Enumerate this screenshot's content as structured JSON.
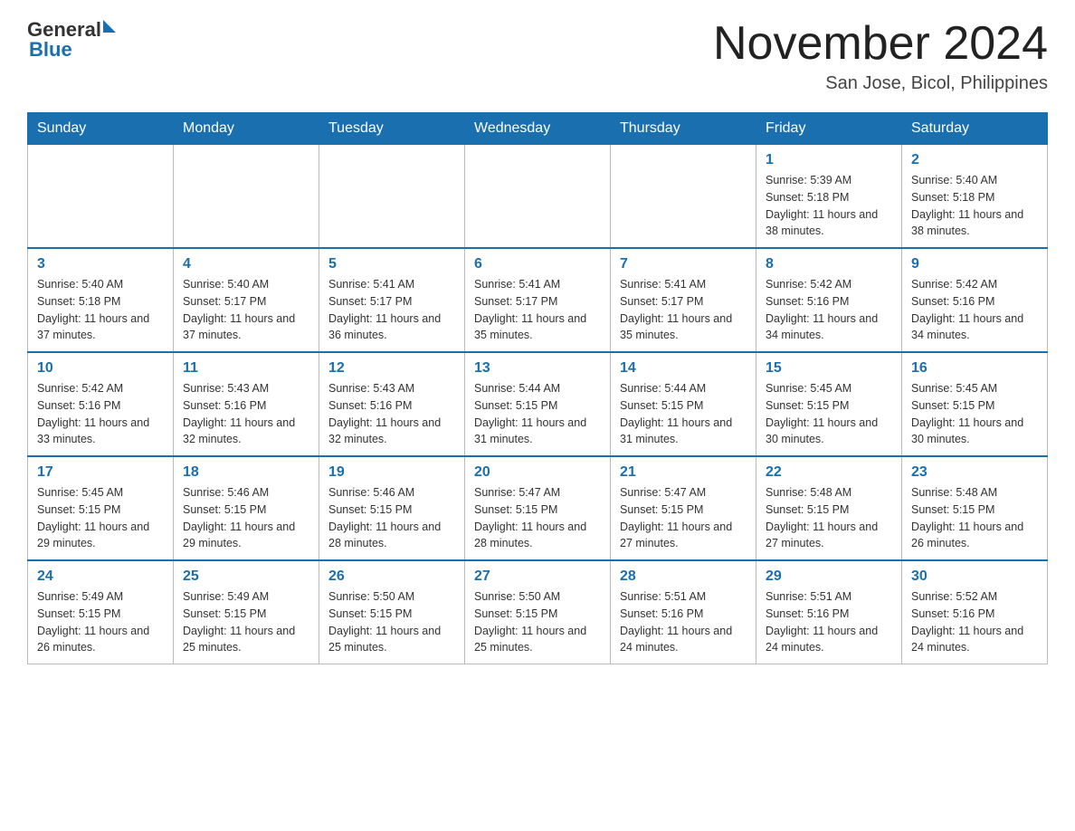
{
  "header": {
    "logo_general": "General",
    "logo_blue": "Blue",
    "month_year": "November 2024",
    "location": "San Jose, Bicol, Philippines"
  },
  "weekdays": [
    "Sunday",
    "Monday",
    "Tuesday",
    "Wednesday",
    "Thursday",
    "Friday",
    "Saturday"
  ],
  "weeks": [
    [
      {
        "day": "",
        "sunrise": "",
        "sunset": "",
        "daylight": ""
      },
      {
        "day": "",
        "sunrise": "",
        "sunset": "",
        "daylight": ""
      },
      {
        "day": "",
        "sunrise": "",
        "sunset": "",
        "daylight": ""
      },
      {
        "day": "",
        "sunrise": "",
        "sunset": "",
        "daylight": ""
      },
      {
        "day": "",
        "sunrise": "",
        "sunset": "",
        "daylight": ""
      },
      {
        "day": "1",
        "sunrise": "Sunrise: 5:39 AM",
        "sunset": "Sunset: 5:18 PM",
        "daylight": "Daylight: 11 hours and 38 minutes."
      },
      {
        "day": "2",
        "sunrise": "Sunrise: 5:40 AM",
        "sunset": "Sunset: 5:18 PM",
        "daylight": "Daylight: 11 hours and 38 minutes."
      }
    ],
    [
      {
        "day": "3",
        "sunrise": "Sunrise: 5:40 AM",
        "sunset": "Sunset: 5:18 PM",
        "daylight": "Daylight: 11 hours and 37 minutes."
      },
      {
        "day": "4",
        "sunrise": "Sunrise: 5:40 AM",
        "sunset": "Sunset: 5:17 PM",
        "daylight": "Daylight: 11 hours and 37 minutes."
      },
      {
        "day": "5",
        "sunrise": "Sunrise: 5:41 AM",
        "sunset": "Sunset: 5:17 PM",
        "daylight": "Daylight: 11 hours and 36 minutes."
      },
      {
        "day": "6",
        "sunrise": "Sunrise: 5:41 AM",
        "sunset": "Sunset: 5:17 PM",
        "daylight": "Daylight: 11 hours and 35 minutes."
      },
      {
        "day": "7",
        "sunrise": "Sunrise: 5:41 AM",
        "sunset": "Sunset: 5:17 PM",
        "daylight": "Daylight: 11 hours and 35 minutes."
      },
      {
        "day": "8",
        "sunrise": "Sunrise: 5:42 AM",
        "sunset": "Sunset: 5:16 PM",
        "daylight": "Daylight: 11 hours and 34 minutes."
      },
      {
        "day": "9",
        "sunrise": "Sunrise: 5:42 AM",
        "sunset": "Sunset: 5:16 PM",
        "daylight": "Daylight: 11 hours and 34 minutes."
      }
    ],
    [
      {
        "day": "10",
        "sunrise": "Sunrise: 5:42 AM",
        "sunset": "Sunset: 5:16 PM",
        "daylight": "Daylight: 11 hours and 33 minutes."
      },
      {
        "day": "11",
        "sunrise": "Sunrise: 5:43 AM",
        "sunset": "Sunset: 5:16 PM",
        "daylight": "Daylight: 11 hours and 32 minutes."
      },
      {
        "day": "12",
        "sunrise": "Sunrise: 5:43 AM",
        "sunset": "Sunset: 5:16 PM",
        "daylight": "Daylight: 11 hours and 32 minutes."
      },
      {
        "day": "13",
        "sunrise": "Sunrise: 5:44 AM",
        "sunset": "Sunset: 5:15 PM",
        "daylight": "Daylight: 11 hours and 31 minutes."
      },
      {
        "day": "14",
        "sunrise": "Sunrise: 5:44 AM",
        "sunset": "Sunset: 5:15 PM",
        "daylight": "Daylight: 11 hours and 31 minutes."
      },
      {
        "day": "15",
        "sunrise": "Sunrise: 5:45 AM",
        "sunset": "Sunset: 5:15 PM",
        "daylight": "Daylight: 11 hours and 30 minutes."
      },
      {
        "day": "16",
        "sunrise": "Sunrise: 5:45 AM",
        "sunset": "Sunset: 5:15 PM",
        "daylight": "Daylight: 11 hours and 30 minutes."
      }
    ],
    [
      {
        "day": "17",
        "sunrise": "Sunrise: 5:45 AM",
        "sunset": "Sunset: 5:15 PM",
        "daylight": "Daylight: 11 hours and 29 minutes."
      },
      {
        "day": "18",
        "sunrise": "Sunrise: 5:46 AM",
        "sunset": "Sunset: 5:15 PM",
        "daylight": "Daylight: 11 hours and 29 minutes."
      },
      {
        "day": "19",
        "sunrise": "Sunrise: 5:46 AM",
        "sunset": "Sunset: 5:15 PM",
        "daylight": "Daylight: 11 hours and 28 minutes."
      },
      {
        "day": "20",
        "sunrise": "Sunrise: 5:47 AM",
        "sunset": "Sunset: 5:15 PM",
        "daylight": "Daylight: 11 hours and 28 minutes."
      },
      {
        "day": "21",
        "sunrise": "Sunrise: 5:47 AM",
        "sunset": "Sunset: 5:15 PM",
        "daylight": "Daylight: 11 hours and 27 minutes."
      },
      {
        "day": "22",
        "sunrise": "Sunrise: 5:48 AM",
        "sunset": "Sunset: 5:15 PM",
        "daylight": "Daylight: 11 hours and 27 minutes."
      },
      {
        "day": "23",
        "sunrise": "Sunrise: 5:48 AM",
        "sunset": "Sunset: 5:15 PM",
        "daylight": "Daylight: 11 hours and 26 minutes."
      }
    ],
    [
      {
        "day": "24",
        "sunrise": "Sunrise: 5:49 AM",
        "sunset": "Sunset: 5:15 PM",
        "daylight": "Daylight: 11 hours and 26 minutes."
      },
      {
        "day": "25",
        "sunrise": "Sunrise: 5:49 AM",
        "sunset": "Sunset: 5:15 PM",
        "daylight": "Daylight: 11 hours and 25 minutes."
      },
      {
        "day": "26",
        "sunrise": "Sunrise: 5:50 AM",
        "sunset": "Sunset: 5:15 PM",
        "daylight": "Daylight: 11 hours and 25 minutes."
      },
      {
        "day": "27",
        "sunrise": "Sunrise: 5:50 AM",
        "sunset": "Sunset: 5:15 PM",
        "daylight": "Daylight: 11 hours and 25 minutes."
      },
      {
        "day": "28",
        "sunrise": "Sunrise: 5:51 AM",
        "sunset": "Sunset: 5:16 PM",
        "daylight": "Daylight: 11 hours and 24 minutes."
      },
      {
        "day": "29",
        "sunrise": "Sunrise: 5:51 AM",
        "sunset": "Sunset: 5:16 PM",
        "daylight": "Daylight: 11 hours and 24 minutes."
      },
      {
        "day": "30",
        "sunrise": "Sunrise: 5:52 AM",
        "sunset": "Sunset: 5:16 PM",
        "daylight": "Daylight: 11 hours and 24 minutes."
      }
    ]
  ]
}
